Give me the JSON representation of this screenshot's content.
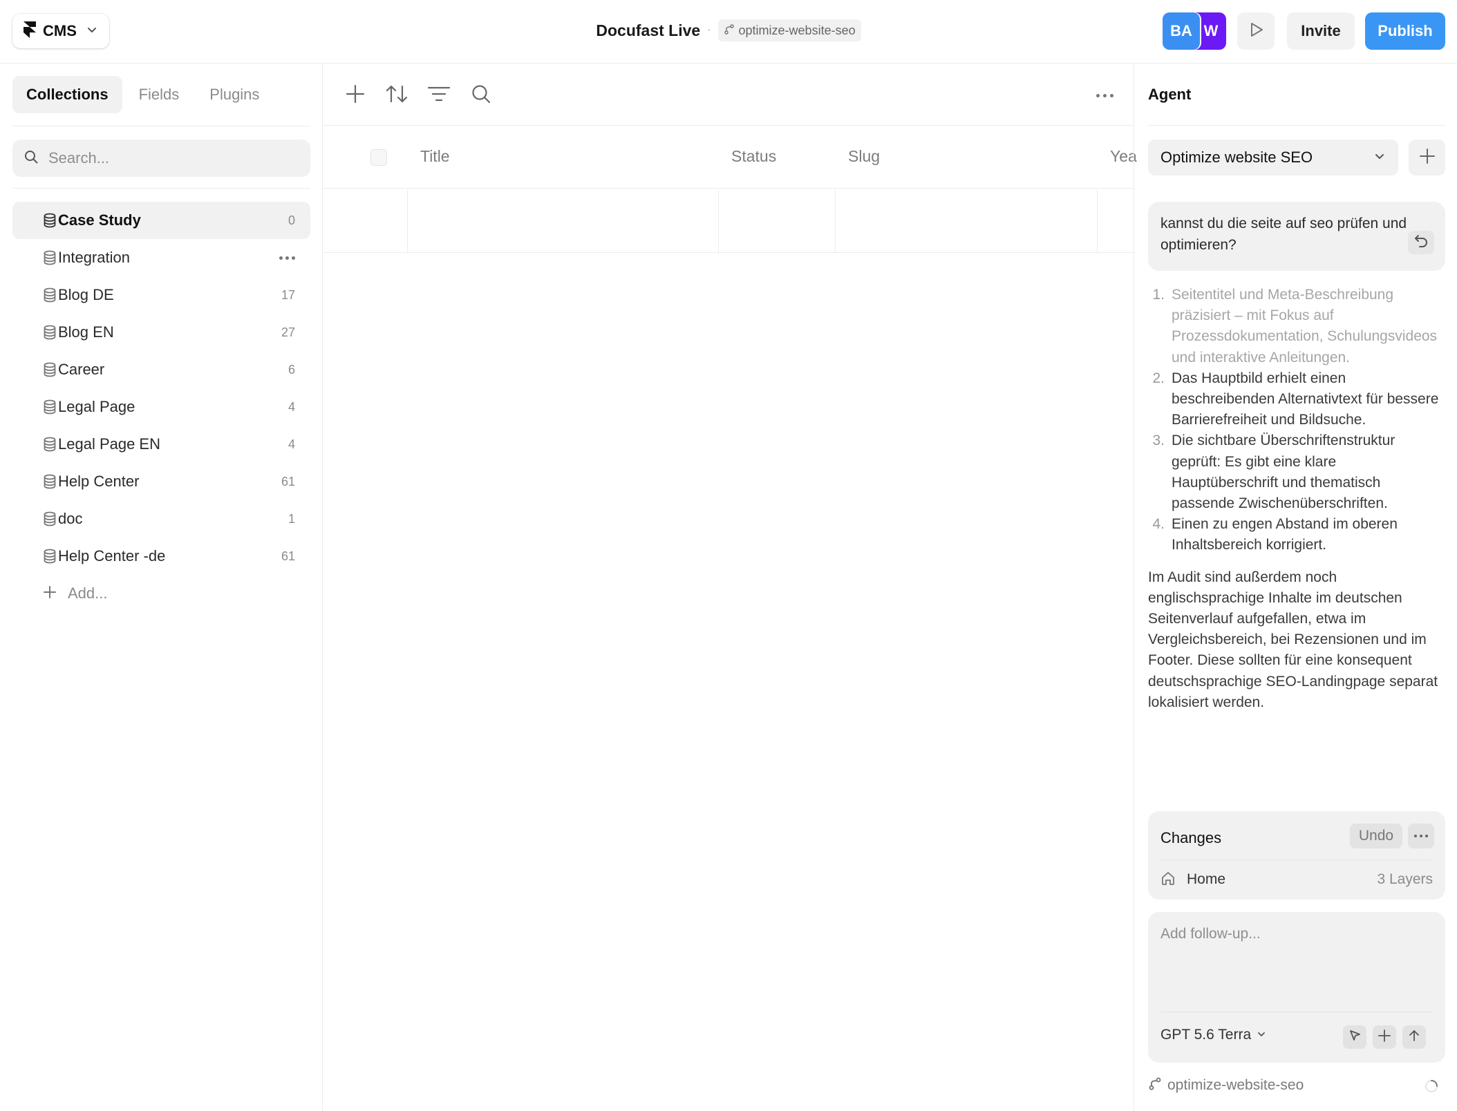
{
  "topbar": {
    "app_label": "CMS",
    "project_title": "Docufast Live",
    "separator": "·",
    "branch": "optimize-website-seo",
    "avatars": [
      {
        "initials": "BA",
        "color": "#3c8ff2"
      },
      {
        "initials": "W",
        "color": "#6b19f5"
      }
    ],
    "invite_label": "Invite",
    "publish_label": "Publish"
  },
  "sidebar": {
    "tabs": [
      {
        "label": "Collections",
        "active": true
      },
      {
        "label": "Fields",
        "active": false
      },
      {
        "label": "Plugins",
        "active": false
      }
    ],
    "search_placeholder": "Search...",
    "collections": [
      {
        "name": "Case Study",
        "count": "0",
        "active": true
      },
      {
        "name": "Integration",
        "count": "",
        "hover_more": true
      },
      {
        "name": "Blog DE",
        "count": "17"
      },
      {
        "name": "Blog EN",
        "count": "27"
      },
      {
        "name": "Career",
        "count": "6"
      },
      {
        "name": "Legal Page",
        "count": "4"
      },
      {
        "name": "Legal Page EN",
        "count": "4"
      },
      {
        "name": "Help Center",
        "count": "61"
      },
      {
        "name": "doc",
        "count": "1"
      },
      {
        "name": "Help Center -de",
        "count": "61"
      }
    ],
    "add_label": "Add..."
  },
  "table": {
    "columns": [
      "Title",
      "Status",
      "Slug",
      "Yea"
    ]
  },
  "agent": {
    "title": "Agent",
    "task": "Optimize website SEO",
    "user_message": "kannst du die seite auf seo prüfen und optimieren?",
    "reply_items": [
      {
        "num": "1.",
        "text": "Seitentitel und Meta-Beschreibung präzisiert – mit Fokus auf Prozessdokumentation, Schulungsvideos und interaktive Anleitungen.",
        "faded": true
      },
      {
        "num": "2.",
        "text": "Das Hauptbild erhielt einen beschreibenden Alternativtext für bessere Barrierefreiheit und Bildsuche."
      },
      {
        "num": "3.",
        "text": "Die sichtbare Überschriftenstruktur geprüft: Es gibt eine klare Hauptüberschrift und thematisch passende Zwischenüberschriften."
      },
      {
        "num": "4.",
        "text": "Einen zu engen Abstand im oberen Inhaltsbereich korrigiert."
      }
    ],
    "reply_paragraph": "Im Audit sind außerdem noch englischsprachige Inhalte im deutschen Seitenverlauf aufgefallen, etwa im Vergleichsbereich, bei Rezensionen und im Footer. Diese sollten für eine konsequent deutschsprachige SEO-Landingpage separat lokalisiert werden.",
    "changes": {
      "title": "Changes",
      "undo_label": "Undo",
      "page": "Home",
      "layers": "3 Layers"
    },
    "composer_placeholder": "Add follow-up...",
    "model": "GPT 5.6 Terra",
    "branch_footer": "optimize-website-seo"
  },
  "colors": {
    "accent": "#3996f5",
    "avatar_ba": "#3c8ff2",
    "avatar_w": "#6b19f5"
  }
}
